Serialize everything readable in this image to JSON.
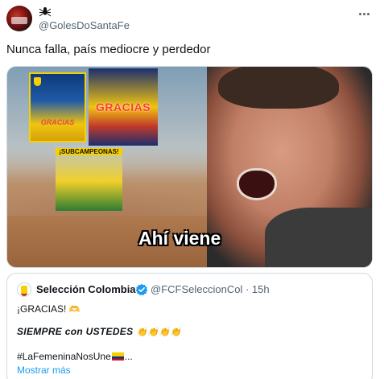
{
  "author": {
    "handle": "@GolesDoSantaFe",
    "name_icon": "spider-icon",
    "avatar_icon": "avatar-image"
  },
  "tweet": {
    "text": "Nunca falla, país mediocre y perdedor"
  },
  "media": {
    "caption": "Ahí viene",
    "thumbnails": [
      {
        "label": "GRACIAS"
      },
      {
        "label": "GRACIAS"
      },
      {
        "label": "¡SUBCAMPEONAS!"
      }
    ]
  },
  "quote": {
    "name": "Selección Colombia",
    "handle": "@FCFSeleccionCol",
    "time": "· 15h",
    "line1": "¡GRACIAS! ",
    "line1_emoji": "🫶",
    "line2": "SIEMPRE con USTEDES ",
    "line2_emoji": "👏👏👏👏",
    "line3": "#LaFemeninaNosUne",
    "line3_suffix": "...",
    "show_more": "Mostrar más"
  },
  "colors": {
    "link": "#1d9bf0",
    "verified": "#1d9bf0",
    "text": "#0f1419",
    "secondary": "#536471"
  }
}
